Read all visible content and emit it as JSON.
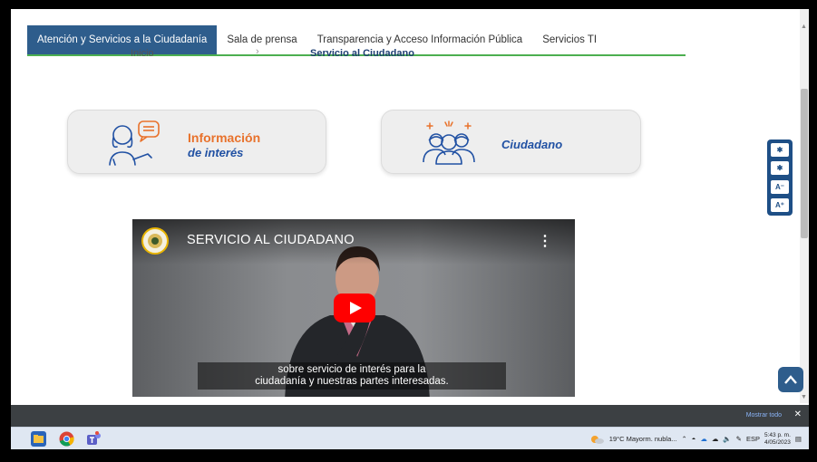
{
  "nav": {
    "tabs": [
      {
        "label": "Atención y Servicios a la Ciudadanía",
        "active": true
      },
      {
        "label": "Sala de prensa",
        "active": false
      },
      {
        "label": "Transparencia y Acceso Información Pública",
        "active": false
      },
      {
        "label": "Servicios TI",
        "active": false
      }
    ]
  },
  "breadcrumb": {
    "home": "Inicio",
    "separator": "›",
    "current": "Servicio al Ciudadano"
  },
  "cards": {
    "info": {
      "title": "Información",
      "subtitle": "de interés",
      "icon": "woman-speech-icon"
    },
    "ciudadano": {
      "label": "Ciudadano",
      "icon": "citizens-group-icon"
    }
  },
  "video": {
    "title": "SERVICIO AL CIUDADANO",
    "subtitle_line1": "sobre servicio de interés para la",
    "subtitle_line2": "ciudadanía y nuestras partes interesadas.",
    "menu_glyph": "⋮"
  },
  "accessibility": {
    "buttons": [
      "✱",
      "✱",
      "A⁻",
      "A⁺"
    ]
  },
  "download_bar": {
    "show_all": "Mostrar todo",
    "close": "✕"
  },
  "taskbar": {
    "weather": "19°C  Mayorm. nubla...",
    "language": "ESP",
    "time": "5:43 p. m.",
    "date": "4/05/2023"
  },
  "colors": {
    "nav_active": "#2e5d8c",
    "orange": "#e8722c",
    "blue_text": "#2151a3",
    "youtube_red": "#ff0000"
  }
}
